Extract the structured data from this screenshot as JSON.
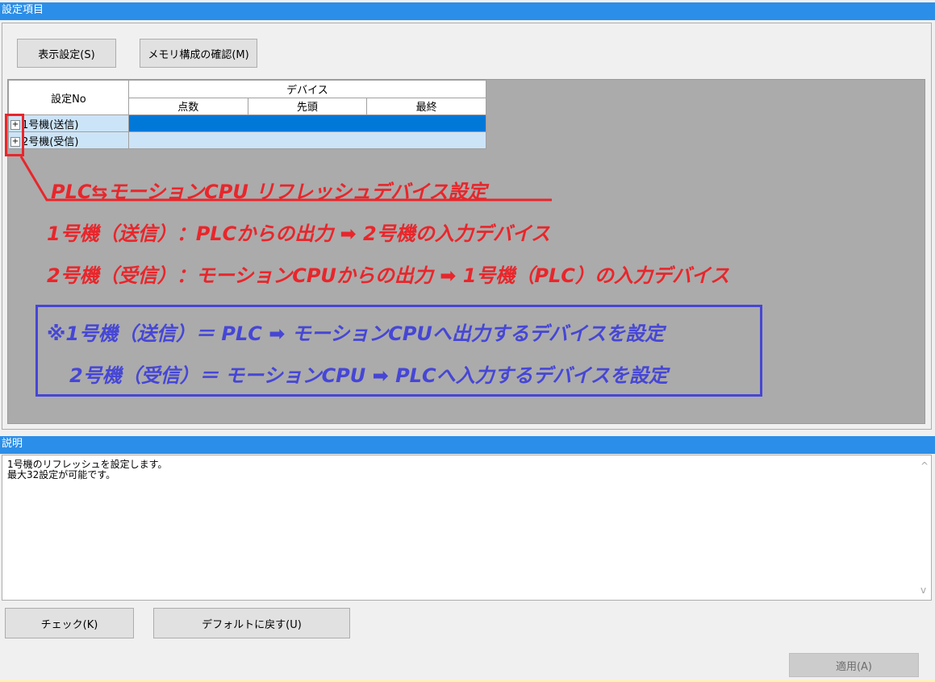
{
  "settings": {
    "title": "設定項目",
    "display_button": "表示設定(S)",
    "memory_button": "メモリ構成の確認(M)"
  },
  "table": {
    "col_setting_no": "設定No",
    "col_device": "デバイス",
    "col_points": "点数",
    "col_start": "先頭",
    "col_end": "最終",
    "rows": [
      {
        "label": "1号機(送信)",
        "expand": "+"
      },
      {
        "label": "2号機(受信)",
        "expand": "+"
      }
    ]
  },
  "annotations": {
    "heading": "PLC⇆モーションCPU リフレッシュデバイス設定",
    "line1": "1号機（送信）：PLCからの出力 ➡ 2号機の入力デバイス",
    "line2": "2号機（受信）：モーションCPUからの出力 ➡ 1号機（PLC）の入力デバイス",
    "note1": "※1号機（送信）＝ PLC ➡ モーションCPUへ出力するデバイスを設定",
    "note2": "2号機（受信）＝ モーションCPU ➡ PLCへ入力するデバイスを設定"
  },
  "description": {
    "title": "説明",
    "text": "1号機のリフレッシュを設定します。\n最大32設定が可能です。",
    "scroll_up": "^",
    "scroll_down": "v"
  },
  "footer": {
    "check_button": "チェック(K)",
    "default_button": "デフォルトに戻す(U)",
    "apply_button": "適用(A)"
  },
  "colors": {
    "title_bar": "#2b8ee8",
    "selected_row": "#0078d7",
    "row_bg": "#cce4f7",
    "annotation_red": "#e8262b",
    "annotation_blue": "#4646d6"
  }
}
